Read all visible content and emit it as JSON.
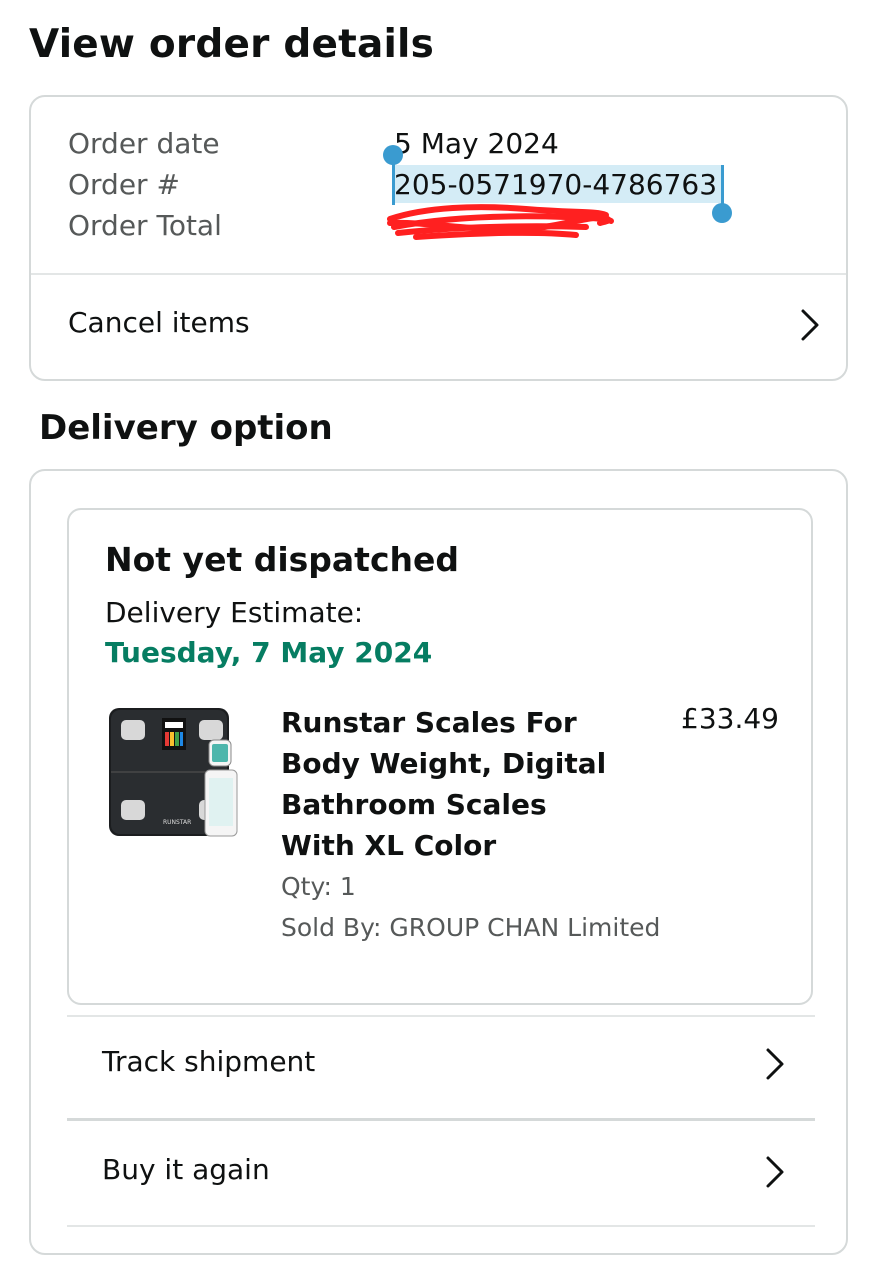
{
  "page": {
    "title": "View order details"
  },
  "order_summary": {
    "date_label": "Order date",
    "date_value": "5 May 2024",
    "number_label": "Order #",
    "number_value": "205-0571970-4786763",
    "total_label": "Order Total",
    "cancel_label": "Cancel items"
  },
  "delivery": {
    "section_title": "Delivery option",
    "status": "Not yet dispatched",
    "estimate_label": "Delivery Estimate:",
    "estimate_date": "Tuesday, 7 May 2024",
    "item": {
      "title": "Runstar Scales For Body Weight, Digital Bathroom Scales With XL Color",
      "price": "£33.49",
      "qty": "Qty: 1",
      "sold_by": "Sold By: GROUP CHAN Limited"
    },
    "track_label": "Track shipment",
    "buy_again_label": "Buy it again"
  },
  "colors": {
    "accent_green": "#067d62",
    "selection": "#3a9bd0",
    "redaction": "#ff2020"
  },
  "icons": {
    "chevron": "chevron-right-icon",
    "product": "product-thumbnail-scale"
  }
}
